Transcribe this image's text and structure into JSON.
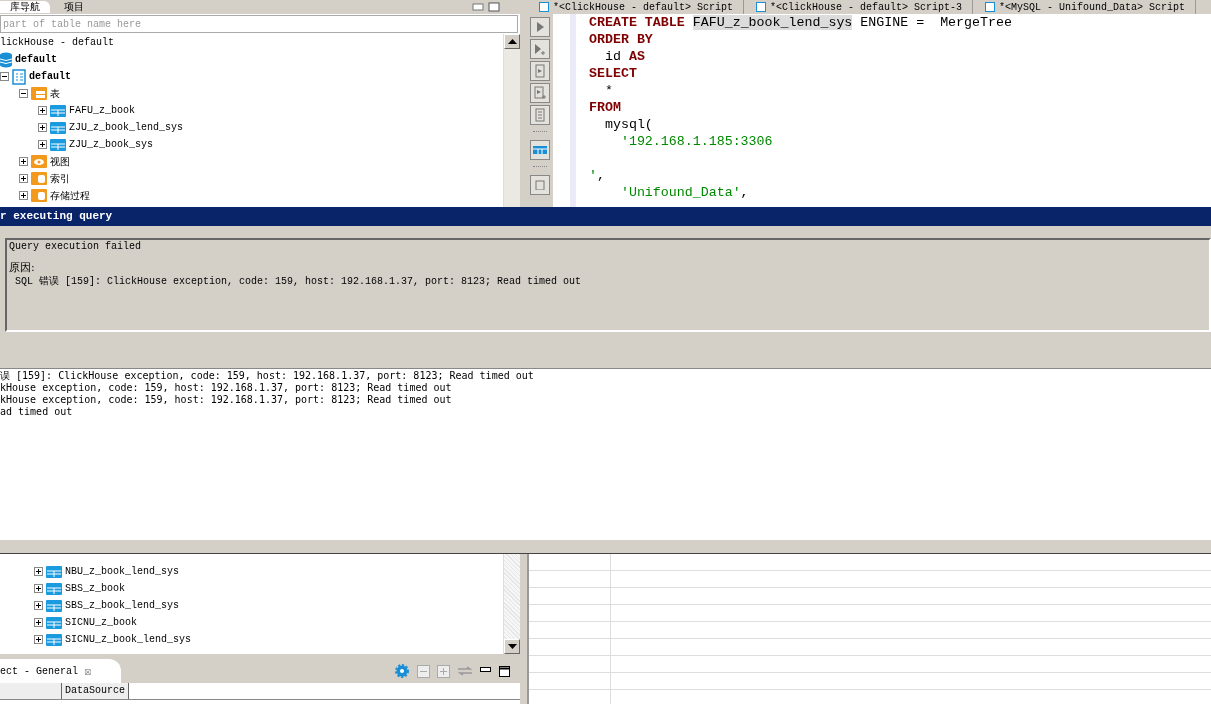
{
  "navigator": {
    "tabs": [
      {
        "label": "库导航",
        "selected": true
      },
      {
        "label": "项目",
        "selected": false
      }
    ],
    "search": {
      "placeholder": "part of table name here"
    },
    "tree": [
      {
        "label": "lickHouse - default",
        "children": [
          {
            "label": "default",
            "kind": "database",
            "children": [
              {
                "label": "default",
                "kind": "schema",
                "expanded": true,
                "children": [
                  {
                    "label": "表",
                    "kind": "folder",
                    "expanded": true,
                    "children": [
                      {
                        "label": "FAFU_z_book",
                        "kind": "table",
                        "expanded": false
                      },
                      {
                        "label": "ZJU_z_book_lend_sys",
                        "kind": "table",
                        "expanded": false
                      },
                      {
                        "label": "ZJU_z_book_sys",
                        "kind": "table",
                        "expanded": false
                      }
                    ]
                  },
                  {
                    "label": "视图",
                    "kind": "views",
                    "expanded": false
                  },
                  {
                    "label": "索引",
                    "kind": "folder-db",
                    "expanded": false
                  },
                  {
                    "label": "存储过程",
                    "kind": "folder-db",
                    "expanded": false
                  }
                ]
              }
            ]
          }
        ]
      }
    ]
  },
  "editor": {
    "tabs": [
      {
        "label": "*<ClickHouse - default> Script",
        "selected": false
      },
      {
        "label": "*<ClickHouse - default> Script-3",
        "selected": false
      },
      {
        "label": "*<MySQL - Unifound_Data> Script",
        "selected": false
      }
    ],
    "lines": [
      {
        "segments": [
          {
            "kind": "keyword",
            "text": "CREATE TABLE"
          },
          {
            "kind": "highlight",
            "text": "FAFU_z_book_lend_sys"
          },
          {
            "kind": "plain",
            "text": " ENGINE =  MergeTree"
          }
        ]
      },
      {
        "segments": [
          {
            "kind": "keyword",
            "text": "ORDER BY"
          }
        ]
      },
      {
        "segments": [
          {
            "kind": "plain",
            "text": "  id "
          },
          {
            "kind": "keyword",
            "text": "AS"
          }
        ]
      },
      {
        "segments": [
          {
            "kind": "keyword",
            "text": "SELECT"
          }
        ]
      },
      {
        "segments": [
          {
            "kind": "plain",
            "text": "  *"
          }
        ]
      },
      {
        "segments": [
          {
            "kind": "keyword",
            "text": "FROM"
          }
        ]
      },
      {
        "segments": [
          {
            "kind": "plain",
            "text": "  mysql("
          }
        ]
      },
      {
        "segments": [
          {
            "kind": "string",
            "text": "    '192.168.1.185:3306"
          }
        ]
      },
      {
        "blank_line_before": true,
        "segments": [
          {
            "kind": "string",
            "text": "'"
          },
          {
            "kind": "plain",
            "text": ","
          }
        ]
      },
      {
        "segments": [
          {
            "kind": "string",
            "text": "    'Unifound_Data'"
          },
          {
            "kind": "plain",
            "text": ","
          }
        ]
      }
    ]
  },
  "dialog": {
    "title": "r executing query",
    "message": "Query execution failed",
    "reason_label": "原因:",
    "reason": " SQL 错误 [159]: ClickHouse exception, code: 159, host: 192.168.1.37, port: 8123; Read timed out"
  },
  "log": [
    "误 [159]: ClickHouse exception, code: 159, host: 192.168.1.37, port: 8123; Read timed out",
    "kHouse exception, code: 159, host: 192.168.1.37, port: 8123; Read timed out",
    "kHouse exception, code: 159, host: 192.168.1.37, port: 8123; Read timed out",
    "ad timed out"
  ],
  "lower_tree": [
    {
      "label": "NBU_z_book_lend_sys",
      "expanded": false
    },
    {
      "label": "SBS_z_book",
      "expanded": false
    },
    {
      "label": "SBS_z_book_lend_sys",
      "expanded": false
    },
    {
      "label": "SICNU_z_book",
      "expanded": false
    },
    {
      "label": "SICNU_z_book_lend_sys",
      "expanded": false
    }
  ],
  "properties": {
    "tab": {
      "label": "ect - General",
      "close": "☒"
    },
    "columns": [
      "DataSource"
    ]
  }
}
